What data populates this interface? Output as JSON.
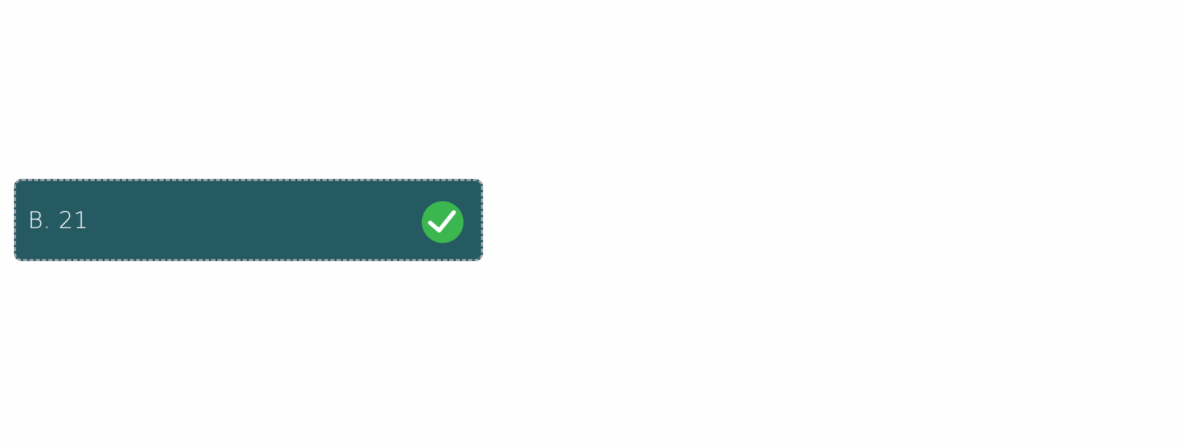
{
  "option": {
    "label": "B. 21",
    "state": "correct",
    "selected": true
  },
  "icons": {
    "status": "check-circle-icon"
  },
  "colors": {
    "option_background": "#265a63",
    "option_border": "#9aa3a6",
    "label_text": "#ffffff",
    "check_fill": "#3cb64f",
    "check_mark": "#ffffff",
    "page_background": "#fefefe"
  }
}
